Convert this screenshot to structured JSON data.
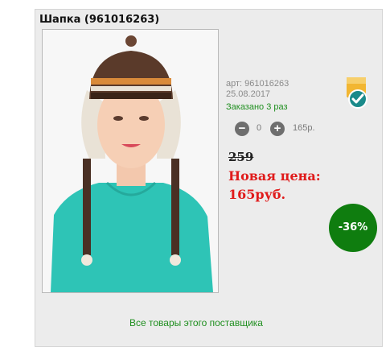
{
  "product": {
    "title": "Шапка (961016263)",
    "art_label": "арт: 961016263",
    "date": "25.08.2017",
    "ordered": "Заказано 3 раз"
  },
  "quantity": {
    "minus_icon": "−",
    "value": "0",
    "plus_icon": "+",
    "unit_price": "165р."
  },
  "price": {
    "old": "259",
    "new_label": "Новая цена:",
    "new_value": "165руб."
  },
  "discount": {
    "label": "-36%"
  },
  "footer": {
    "supplier_link": "Все товары этого поставщика"
  },
  "colors": {
    "accent_green": "#0f7d0f",
    "price_red": "#e01b1b",
    "badge_gold": "#f2b632",
    "badge_teal": "#1a8a8a"
  }
}
